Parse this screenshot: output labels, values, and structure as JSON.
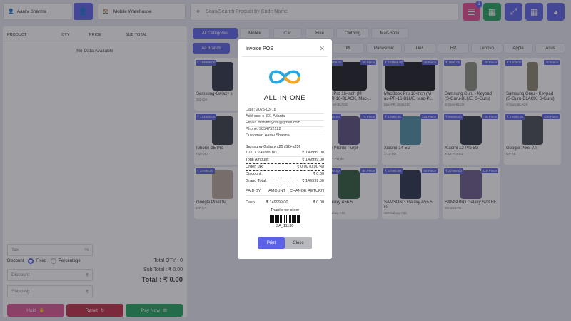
{
  "topbar": {
    "customer": "Aarav Sharma",
    "warehouse": "Mobile Warehouse",
    "search_placeholder": "Scan/Search Product by Code Name",
    "cart_badge": "1"
  },
  "cart": {
    "headers": [
      "PRODUCT",
      "QTY",
      "PRICE",
      "SUB TOTAL"
    ],
    "empty_text": "No Data Available",
    "tax_placeholder": "Tax",
    "tax_unit": "%",
    "discount_label": "Discount",
    "fixed_label": "Fixed",
    "percentage_label": "Percentage",
    "discount_placeholder": "Discount",
    "shipping_placeholder": "Shipping",
    "currency": "₹",
    "total_qty": "Total QTY : 0",
    "sub_total": "Sub Total : ₹ 0.00",
    "total": "Total : ₹ 0.00",
    "hold_label": "Hold",
    "reset_label": "Reset",
    "paynow_label": "Pay Now"
  },
  "categories": [
    "All Categories",
    "Mobile",
    "Car",
    "Bike",
    "Clothing",
    "Mac-Book"
  ],
  "brands": [
    "All Brands",
    "Mi",
    "Panasonic",
    "Dell",
    "HP",
    "Lenovo",
    "Apple",
    "Asus"
  ],
  "products_visible": [
    {
      "price": "₹ 169999.00",
      "name": "Samsung-Galaxy s",
      "code": "SG-s25"
    },
    {
      "price": "₹ 124999.00",
      "stock": "49 Piece",
      "name": "Book Pro 16-inch (M",
      "name2": "oc-PR-16-BLACK, Mac-...",
      "code": "oc-PR-16-BLACK"
    },
    {
      "price": "₹ 224999.00",
      "stock": "49 Piece",
      "name": "MacBook Pro 16-inch (M",
      "name2": "ac-PR-16-BLUE, Mac-P...",
      "code": "Mac-PR-16-BLUE"
    },
    {
      "price": "₹ 1500.00",
      "stock": "40 Piece",
      "name": "Samsung Guru - Keypad",
      "name2": "(S-Guru-BLUE, S-Guru)",
      "code": "S-Guru-BLUE"
    },
    {
      "price": "₹ 1500.00",
      "stock": "40 Piece",
      "name": "Samsung Guru - Keypad",
      "name2": "(S-Guru-BLACK, S-Guru)",
      "code": "S-Guru-BLACK"
    },
    {
      "price": "₹ 134900.00",
      "name": "Iphone-15 Pro",
      "code": "I-15-pro"
    },
    {
      "price": "₹ 19999.00",
      "stock": "75 Piece",
      "name": "ix 5G Pronto Purpl",
      "code": "ix-5G-P-Purple"
    },
    {
      "price": "₹ 12999.00",
      "stock": "125 Piece",
      "name": "Xiaomi-14-5G",
      "code": "X-14-5G"
    },
    {
      "price": "₹ 64999.00",
      "stock": "50 Piece",
      "name": "Xiaomi 12 Pro 5G",
      "code": "X-12-Pro-5G"
    },
    {
      "price": "₹ 79999.00",
      "stock": "100 Piece",
      "name": "Google-Pixel 7A",
      "code": "GP-7a"
    },
    {
      "price": "₹ 27999.00",
      "name": "Google Pixel 9a",
      "code": "GP-9A"
    },
    {
      "price": "₹ 31999.00",
      "stock": "85 Piece",
      "name": "G Galaxy A56 5",
      "code": "SM-Galaxy-A56"
    },
    {
      "price": "₹ 27999.00",
      "stock": "50 Piece",
      "name": "SAMSUNG Galaxy A55 5",
      "name2": "G",
      "code": "SM-Galaxy-A55"
    },
    {
      "price": "₹ 27999.00",
      "stock": "110 Piece",
      "name": "SAMSUNG Galaxy S23 FE",
      "code": "SG-S23-FE"
    }
  ],
  "invoice": {
    "title": "Invoice POS",
    "company": "ALL-IN-ONE",
    "date": "Date: 2025-03-18",
    "address": "Address: c-301 Atlanta",
    "email": "Email: mohitinfyom@gmail.com",
    "phone": "Phone: 9854752122",
    "customer": "Customer: Aarav Sharma",
    "item_name": "Samsung-Galaxy s25 (SG-s25)",
    "item_qty": "1.00 X 149999.00",
    "item_total": "₹ 149999.00",
    "total_amount_label": "Total Amount:",
    "total_amount": "₹ 149999.00",
    "order_tax_label": "Order Tax:",
    "order_tax": "₹ 0.00 (0.00 %)",
    "discount_label": "Discount:",
    "discount": "₹ 0.00",
    "shipping_label": "Shipping:",
    "shipping": "₹ 0.00",
    "grand_total_label": "Grand Total:",
    "grand_total": "₹ 149999.00",
    "col_paid_by": "PAID BY",
    "col_amount": "AMOUNT",
    "col_change": "CHANGE RETURN",
    "pay_method": "Cash",
    "pay_amount": "₹ 149999.00",
    "pay_change": "₹ 0.00",
    "thanks": "Thanks for order",
    "invoice_code": "SA_11130",
    "print_label": "Print",
    "close_label": "Close"
  },
  "colors": {
    "accent": "#5b62e6",
    "pink": "#e34c8f",
    "green": "#1fa35b",
    "red": "#c42b44"
  }
}
